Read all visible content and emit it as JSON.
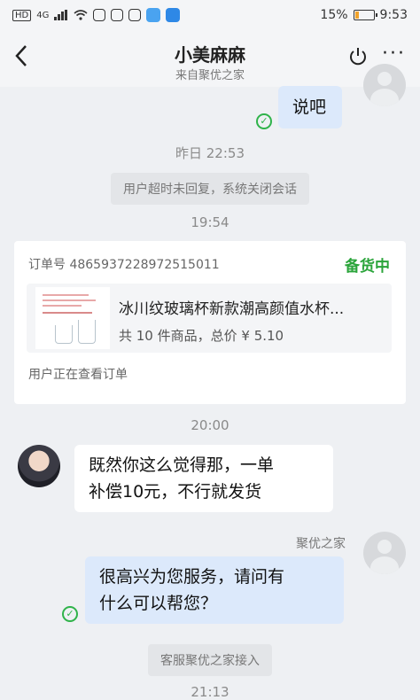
{
  "status_bar": {
    "left": "HD",
    "signal": "4G",
    "battery": "15%",
    "time": "9:53"
  },
  "header": {
    "title": "小美麻麻",
    "subtitle": "来自聚优之家"
  },
  "messages": {
    "m1": "说吧",
    "t1": "昨日 22:53",
    "sys1": "用户超时未回复，系统关闭会话",
    "t2": "19:54",
    "t3": "20:00",
    "m2_line1": "既然你这么觉得那，一单",
    "m2_line2": "补偿10元，不行就发货",
    "sender": "聚优之家",
    "m3_line1": "很高兴为您服务，请问有",
    "m3_line2": "什么可以帮您？",
    "sys2": "客服聚优之家接入",
    "t4": "21:13"
  },
  "order": {
    "number": "订单号 4865937228972515011",
    "status": "备货中",
    "product_name": "冰川纹玻璃杯新款潮高颜值水杯...",
    "summary": "共 10 件商品，总价 ¥ 5.10",
    "note": "用户正在查看订单"
  },
  "colors": {
    "accent_green": "#2aa43a",
    "bubble_blue": "#dce9fb"
  }
}
